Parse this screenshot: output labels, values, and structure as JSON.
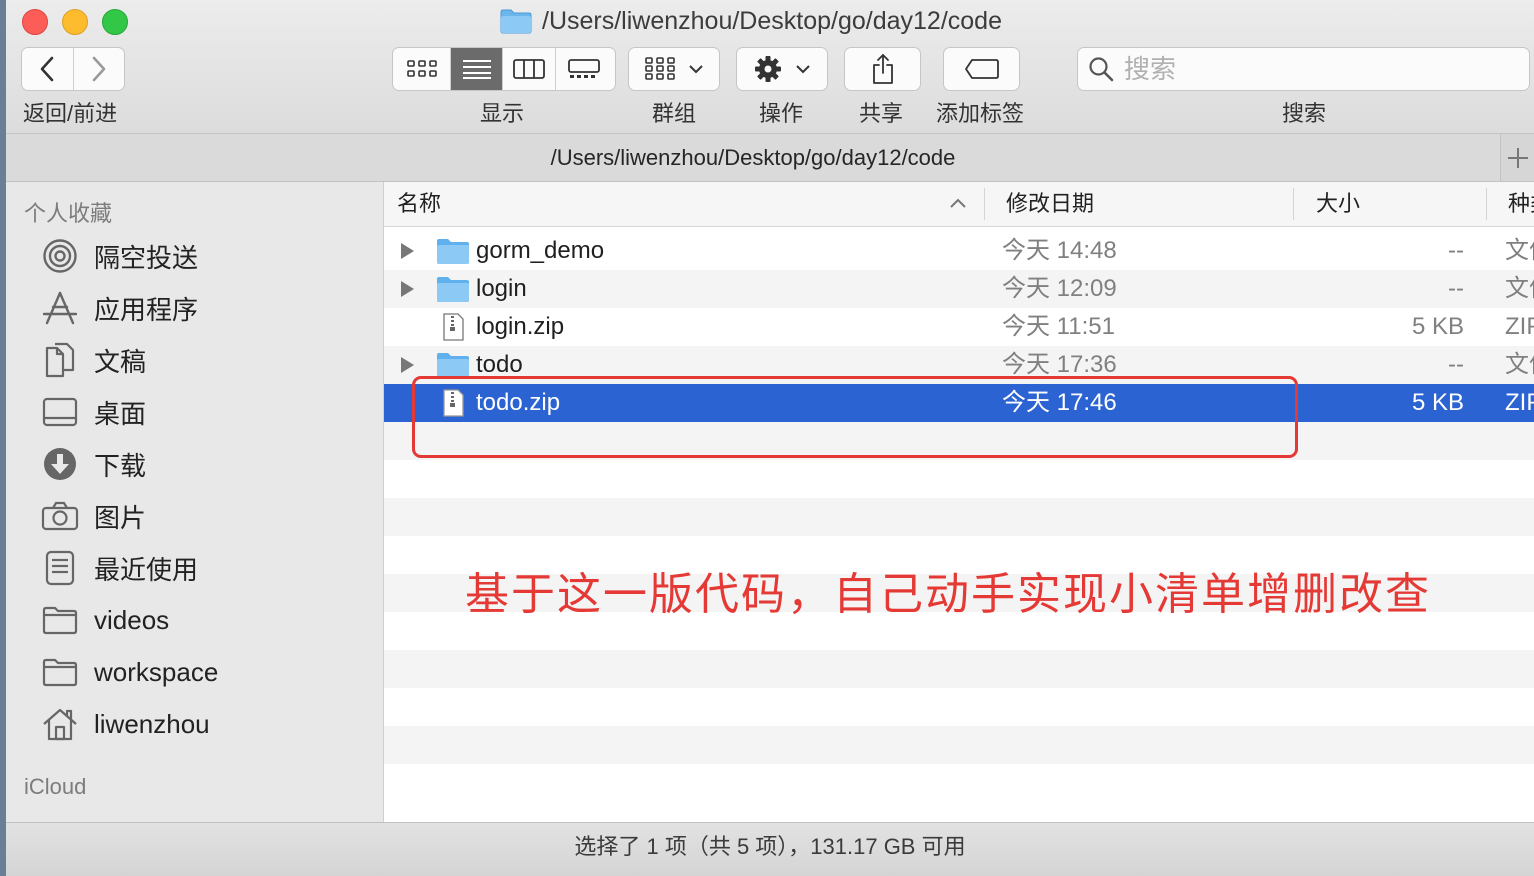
{
  "window": {
    "title": "/Users/liwenzhou/Desktop/go/day12/code"
  },
  "toolbar": {
    "back_forward_label": "返回/前进",
    "view_label": "显示",
    "group_label": "群组",
    "action_label": "操作",
    "share_label": "共享",
    "tags_label": "添加标签",
    "search_label": "搜索",
    "search_placeholder": "搜索"
  },
  "pathbar": {
    "path": "/Users/liwenzhou/Desktop/go/day12/code"
  },
  "sidebar": {
    "favorites_heading": "个人收藏",
    "items": [
      {
        "label": "隔空投送",
        "icon": "airdrop-icon"
      },
      {
        "label": "应用程序",
        "icon": "applications-icon"
      },
      {
        "label": "文稿",
        "icon": "documents-icon"
      },
      {
        "label": "桌面",
        "icon": "desktop-icon"
      },
      {
        "label": "下载",
        "icon": "downloads-icon"
      },
      {
        "label": "图片",
        "icon": "pictures-icon"
      },
      {
        "label": "最近使用",
        "icon": "recents-icon"
      },
      {
        "label": "videos",
        "icon": "folder-icon"
      },
      {
        "label": "workspace",
        "icon": "folder-icon"
      },
      {
        "label": "liwenzhou",
        "icon": "home-icon"
      }
    ],
    "icloud_heading": "iCloud"
  },
  "columns": {
    "name": "名称",
    "date": "修改日期",
    "size": "大小",
    "kind": "种类"
  },
  "files": [
    {
      "name": "gorm_demo",
      "date": "今天 14:48",
      "size": "--",
      "kind": "文件夹",
      "type": "folder"
    },
    {
      "name": "login",
      "date": "今天 12:09",
      "size": "--",
      "kind": "文件夹",
      "type": "folder"
    },
    {
      "name": "login.zip",
      "date": "今天 11:51",
      "size": "5 KB",
      "kind": "ZIP",
      "type": "zip"
    },
    {
      "name": "todo",
      "date": "今天 17:36",
      "size": "--",
      "kind": "文件夹",
      "type": "folder"
    },
    {
      "name": "todo.zip",
      "date": "今天 17:46",
      "size": "5 KB",
      "kind": "ZIP",
      "type": "zip",
      "selected": true
    }
  ],
  "annotation": {
    "text": "基于这一版代码，自己动手实现小清单增删改查",
    "color": "#e53935"
  },
  "status": {
    "text": "选择了 1 项（共 5 项），131.17 GB 可用"
  },
  "colors": {
    "selection": "#2b63d3",
    "folder": "#6cb6ee"
  }
}
